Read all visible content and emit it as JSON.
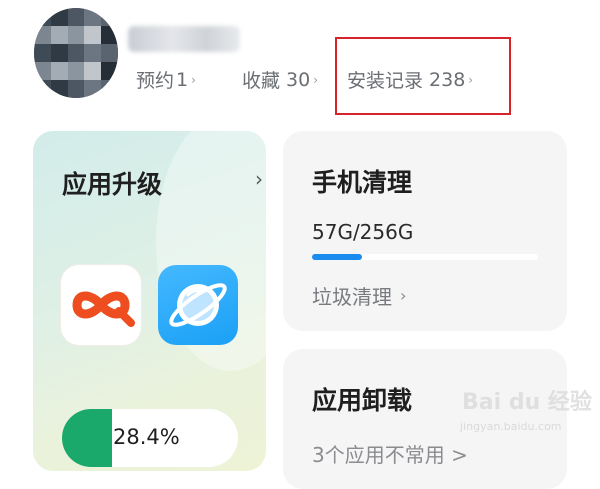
{
  "profile": {
    "stats": [
      {
        "label": "预约",
        "count": "1"
      },
      {
        "label": "收藏",
        "count": "30"
      },
      {
        "label": "安装记录",
        "count": "238"
      }
    ],
    "chevron": "›"
  },
  "cards": {
    "upgrade": {
      "title": "应用升级",
      "chevron": "›",
      "apps": [
        {
          "icon": "infinity-logo-icon"
        },
        {
          "icon": "planet-browser-icon"
        }
      ],
      "progress_text": "28.4%",
      "progress_fraction": 0.284
    },
    "clean": {
      "title": "手机清理",
      "storage_text": "57G/256G",
      "storage_fraction": 0.22,
      "link_label": "垃圾清理",
      "link_chevron": "›"
    },
    "uninstall": {
      "title": "应用卸载",
      "link_label": "3个应用不常用 >"
    }
  },
  "colors": {
    "highlight": "#d9232a",
    "progress": "#1aa96a",
    "storage": "#1a8cf0"
  },
  "watermark": {
    "main": "Bai du 经验",
    "sub": "jingyan.baidu.com"
  }
}
